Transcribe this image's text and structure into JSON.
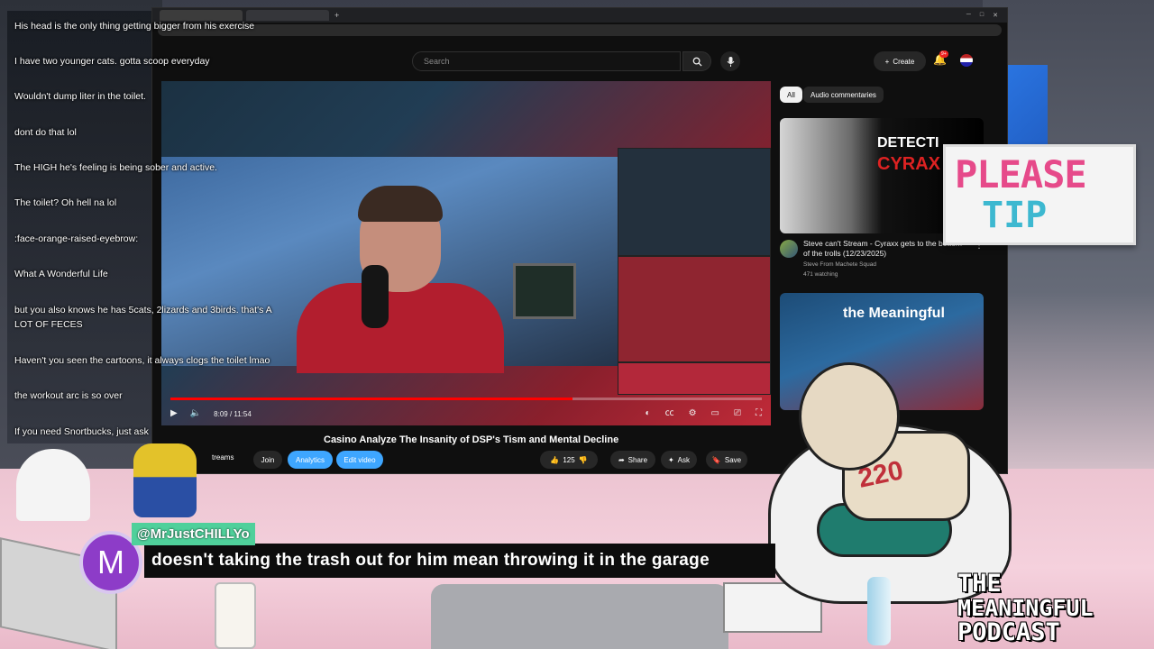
{
  "chat": {
    "messages": [
      {
        "user": "",
        "text": "His head is the only thing getting bigger from his exercise"
      },
      {
        "user": "",
        "text": "I have two younger cats. gotta scoop everyday"
      },
      {
        "user": "",
        "text": "Wouldn't dump liter in the toilet."
      },
      {
        "user": "",
        "text": "dont do that lol"
      },
      {
        "user": "",
        "text": "The HIGH he's feeling is being sober and active."
      },
      {
        "user": "",
        "text": "The toilet? Oh hell na lol"
      },
      {
        "user": "",
        "text": ":face-orange-raised-eyebrow:"
      },
      {
        "user": "",
        "text": "What A Wonderful Life"
      },
      {
        "user": "",
        "text": "but you also knows he has 5cats, 2lizards and 3birds. that's A"
      },
      {
        "user": "",
        "text": "LOT OF FECES"
      },
      {
        "user": "",
        "text": "Haven't you seen the cartoons, it always clogs the toilet lmao"
      },
      {
        "user": "",
        "text": "the workout arc is so over"
      },
      {
        "user": "",
        "text": "If you need Snortbucks, just ask"
      }
    ]
  },
  "youtube": {
    "search_placeholder": "Search",
    "create_label": "Create",
    "notification_count": "9+",
    "player": {
      "time": "8:09 / 11:54",
      "progress": 0.68
    },
    "video_title": "Casino Analyze The Insanity of DSP's Tism and Mental Decline",
    "channel_fragment": "treams",
    "buttons": {
      "join": "Join",
      "analytics": "Analytics",
      "edit_video": "Edit video",
      "likes": "125",
      "share": "Share",
      "ask": "Ask",
      "save": "Save"
    },
    "chips": {
      "all": "All",
      "audio": "Audio commentaries"
    },
    "recommendations": [
      {
        "thumb_line1": "DETECTI",
        "thumb_line2": "CYRAX",
        "title": "Steve can't Stream - Cyraxx gets to the bottom of the trolls (12/23/2025)",
        "channel": "Steve From Machete Squad",
        "views": "471 watching"
      },
      {
        "thumb_line1": "the Meaningful"
      }
    ]
  },
  "caption": {
    "avatar_letter": "M",
    "username": "@MrJustCHILLYo",
    "message": "doesn't taking the trash out for him mean throwing it in the garage"
  },
  "overlay": {
    "tip_line1": "PLEASE",
    "tip_line2": "TIP",
    "podcast_line1": "THE",
    "podcast_line2": "MEANINGFUL",
    "podcast_line3": "PODCAST",
    "shirt_number": "220"
  },
  "colors": {
    "youtube_red": "#ff0000",
    "analytics_blue": "#3ea6ff",
    "caption_name_bg": "#4fd09b",
    "caption_avatar": "#8d3cc8"
  }
}
